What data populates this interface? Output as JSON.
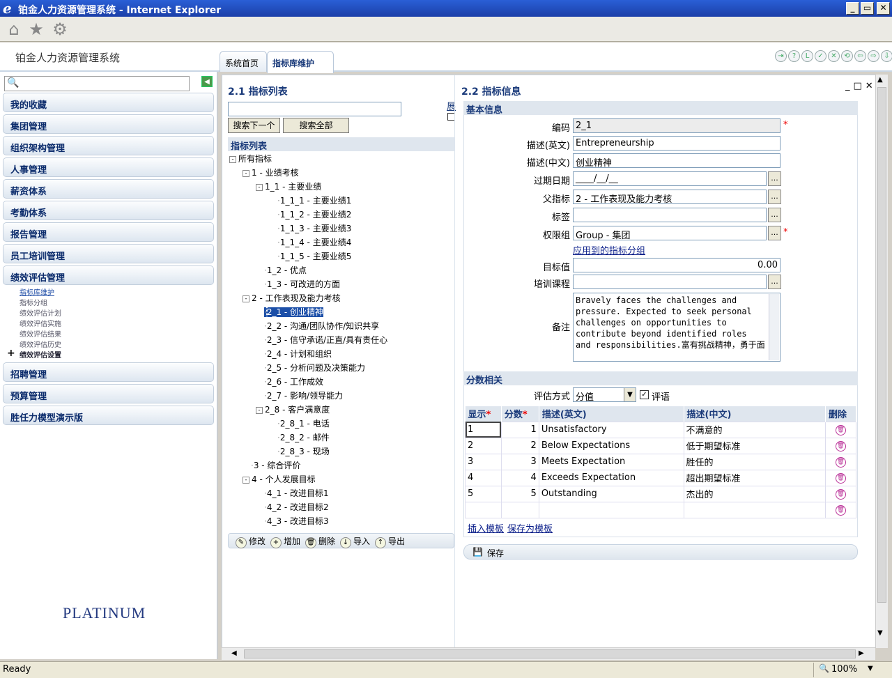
{
  "window": {
    "title": "铂金人力资源管理系统 - Internet Explorer",
    "min": "_",
    "max": "▭",
    "close": "✕"
  },
  "toolbar": {
    "home_icon": "⌂",
    "star_icon": "★",
    "gear_icon": "⚙"
  },
  "app": {
    "title": "铂金人力资源管理系统",
    "tabs": [
      "系统首页",
      "指标库维护"
    ]
  },
  "header_icons": [
    "⇥",
    "?",
    "L",
    "✓",
    "✕",
    "⟲",
    "⇦",
    "⇨",
    "⇩"
  ],
  "left": {
    "search_placeholder": "",
    "search_icon": "🔍",
    "collapse_icon": "◀",
    "nav": [
      "我的收藏",
      "集团管理",
      "组织架构管理",
      "人事管理",
      "薪资体系",
      "考勤体系",
      "报告管理",
      "员工培训管理",
      "绩效评估管理"
    ],
    "sub": [
      "指标库维护",
      "指标分组",
      "绩效评估计划",
      "绩效评估实施",
      "绩效评估结果",
      "绩效评估历史",
      "绩效评估设置"
    ],
    "nav2": [
      "招聘管理",
      "预算管理",
      "胜任力模型演示版"
    ],
    "logo": "PLATINUM"
  },
  "list": {
    "title": "2.1 指标列表",
    "btn_next": "搜索下一个",
    "btn_all": "搜索全部",
    "right_label": "展",
    "bar": "指标列表",
    "tree": [
      {
        "t": "所有指标",
        "l": 0,
        "e": "-"
      },
      {
        "t": "1 - 业绩考核",
        "l": 1,
        "e": "-"
      },
      {
        "t": "1_1 - 主要业绩",
        "l": 2,
        "e": "-"
      },
      {
        "t": "1_1_1 - 主要业绩1",
        "l": 3
      },
      {
        "t": "1_1_2 - 主要业绩2",
        "l": 3
      },
      {
        "t": "1_1_3 - 主要业绩3",
        "l": 3
      },
      {
        "t": "1_1_4 - 主要业绩4",
        "l": 3
      },
      {
        "t": "1_1_5 - 主要业绩5",
        "l": 3
      },
      {
        "t": "1_2 - 优点",
        "l": 2
      },
      {
        "t": "1_3 - 可改进的方面",
        "l": 2
      },
      {
        "t": "2 - 工作表现及能力考核",
        "l": 1,
        "e": "-"
      },
      {
        "t": "2_1 - 创业精神",
        "l": 2,
        "sel": true
      },
      {
        "t": "2_2 - 沟通/团队协作/知识共享",
        "l": 2
      },
      {
        "t": "2_3 - 信守承诺/正直/具有责任心",
        "l": 2
      },
      {
        "t": "2_4 - 计划和组织",
        "l": 2
      },
      {
        "t": "2_5 - 分析问题及决策能力",
        "l": 2
      },
      {
        "t": "2_6 - 工作成效",
        "l": 2
      },
      {
        "t": "2_7 - 影响/领导能力",
        "l": 2
      },
      {
        "t": "2_8 - 客户满意度",
        "l": 2,
        "e": "-"
      },
      {
        "t": "2_8_1 - 电话",
        "l": 3
      },
      {
        "t": "2_8_2 - 邮件",
        "l": 3
      },
      {
        "t": "2_8_3 - 现场",
        "l": 3
      },
      {
        "t": "3 - 综合评价",
        "l": 1
      },
      {
        "t": "4 - 个人发展目标",
        "l": 1,
        "e": "-"
      },
      {
        "t": "4_1 - 改进目标1",
        "l": 2
      },
      {
        "t": "4_2 - 改进目标2",
        "l": 2
      },
      {
        "t": "4_3 - 改进目标3",
        "l": 2
      }
    ],
    "actions": [
      {
        "i": "✎",
        "t": "修改"
      },
      {
        "i": "+",
        "t": "增加"
      },
      {
        "i": "🗑",
        "t": "删除"
      },
      {
        "i": "↓",
        "t": "导入"
      },
      {
        "i": "↑",
        "t": "导出"
      }
    ]
  },
  "detail": {
    "title": "2.2 指标信息",
    "win_icons": [
      "_",
      "□",
      "✕"
    ],
    "basic": "基本信息",
    "fields": [
      {
        "label": "编码",
        "value": "2_1"
      },
      {
        "label": "描述(英文)",
        "value": "Entrepreneurship"
      },
      {
        "label": "描述(中文)",
        "value": "创业精神"
      },
      {
        "label": "过期日期",
        "value": "____/__/__"
      },
      {
        "label": "父指标",
        "value": "2 - 工作表现及能力考核"
      },
      {
        "label": "标签",
        "value": ""
      },
      {
        "label": "权限组",
        "value": "Group - 集团"
      },
      {
        "label": "目标值",
        "value": "0.00"
      },
      {
        "label": "培训课程",
        "value": ""
      },
      {
        "label": "备注",
        "value": "Bravely faces the challenges and pressure. Expected to seek personal challenges on opportunities to contribute beyond identified roles and responsibilities.富有挑战精神，勇于面"
      }
    ],
    "applied_link": "应用到的指标分组",
    "pick": "...",
    "req": "*",
    "score": "分数相关",
    "method_label": "评估方式",
    "method_value": "分值",
    "comment_label": "评语",
    "cols": [
      "显示",
      "分数",
      "描述(英文)",
      "描述(中文)",
      "删除"
    ],
    "rows": [
      {
        "show": "1",
        "score": "1",
        "en": "Unsatisfactory",
        "cn": "不满意的"
      },
      {
        "show": "2",
        "score": "2",
        "en": "Below Expectations",
        "cn": "低于期望标准"
      },
      {
        "show": "3",
        "score": "3",
        "en": "Meets Expectation",
        "cn": "胜任的"
      },
      {
        "show": "4",
        "score": "4",
        "en": "Exceeds Expectation",
        "cn": "超出期望标准"
      },
      {
        "show": "5",
        "score": "5",
        "en": "Outstanding",
        "cn": "杰出的"
      },
      {
        "show": "",
        "score": "",
        "en": "",
        "cn": ""
      }
    ],
    "insert_tpl": "插入模板",
    "save_tpl": "保存为模板",
    "save": "保存"
  },
  "status": {
    "text": "Ready",
    "zoom": "100%"
  }
}
